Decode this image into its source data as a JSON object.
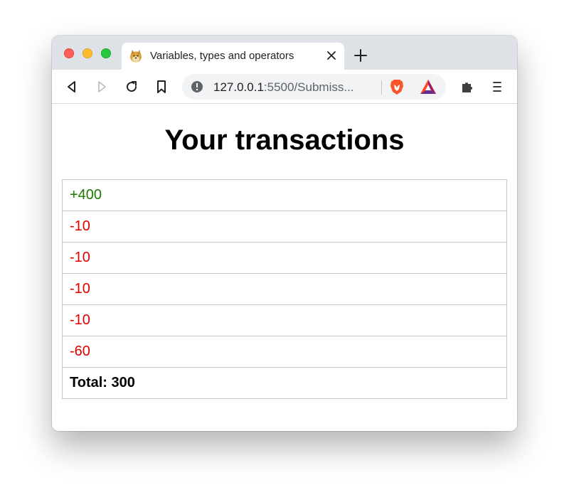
{
  "browser": {
    "tab_title": "Variables, types and operators",
    "url_host": "127.0.0.1",
    "url_rest": ":5500/Submiss...",
    "icons": {
      "back": "back-arrow-icon",
      "forward": "forward-arrow-icon",
      "reload": "reload-icon",
      "bookmark": "bookmark-icon",
      "site_info": "site-info-icon",
      "brave": "brave-lion-icon",
      "rewards": "bat-rewards-icon",
      "extensions": "puzzle-extensions-icon",
      "menu": "menu-icon"
    }
  },
  "page": {
    "title": "Your transactions",
    "transactions": [
      {
        "text": "+400",
        "color": "#1a7a00"
      },
      {
        "text": "-10",
        "color": "#e00000"
      },
      {
        "text": "-10",
        "color": "#e00000"
      },
      {
        "text": "-10",
        "color": "#e00000"
      },
      {
        "text": "-10",
        "color": "#e00000"
      },
      {
        "text": "-60",
        "color": "#e00000"
      }
    ],
    "total": "Total: 300"
  }
}
